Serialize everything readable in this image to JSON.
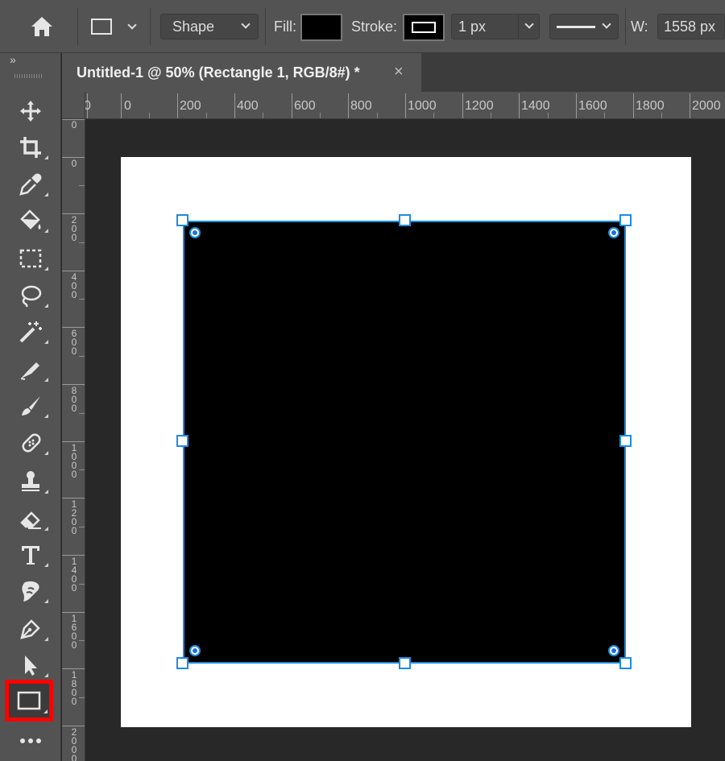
{
  "options_bar": {
    "home_icon": "home-icon",
    "shape_mode_icon": "rectangle-shape-icon",
    "mode_select": "Shape",
    "fill_label": "Fill:",
    "fill_color": "#000000",
    "stroke_label": "Stroke:",
    "stroke_icon": "stroke-swatch-icon",
    "stroke_width": "1 px",
    "stroke_style_icon": "stroke-line-style-icon",
    "width_label": "W:",
    "width_value": "1558 px"
  },
  "toolbar": {
    "collapse_icon": "»",
    "tools": [
      {
        "name": "move-tool",
        "icon": "move-icon"
      },
      {
        "name": "crop-tool",
        "icon": "crop-icon"
      },
      {
        "name": "eyedropper-tool",
        "icon": "eyedropper-icon"
      },
      {
        "name": "paint-bucket-tool",
        "icon": "paint-bucket-icon"
      },
      {
        "name": "marquee-tool",
        "icon": "rectangular-marquee-icon"
      },
      {
        "name": "lasso-tool",
        "icon": "lasso-icon"
      },
      {
        "name": "magic-wand-tool",
        "icon": "magic-wand-icon"
      },
      {
        "name": "eraser-tool",
        "icon": "eraser-icon"
      },
      {
        "name": "brush-tool",
        "icon": "brush-icon"
      },
      {
        "name": "healing-brush-tool",
        "icon": "bandage-icon"
      },
      {
        "name": "clone-stamp-tool",
        "icon": "stamp-icon"
      },
      {
        "name": "background-eraser-tool",
        "icon": "background-eraser-icon"
      },
      {
        "name": "type-tool",
        "icon": "type-icon"
      },
      {
        "name": "smudge-tool",
        "icon": "smudge-finger-icon"
      },
      {
        "name": "pen-tool",
        "icon": "pen-icon"
      },
      {
        "name": "path-selection-tool",
        "icon": "arrow-selection-icon"
      },
      {
        "name": "rectangle-tool",
        "icon": "rectangle-icon",
        "active": true
      },
      {
        "name": "more-tools",
        "icon": "ellipsis-icon"
      }
    ],
    "highlight_color": "#ff0000"
  },
  "document": {
    "tab_title": "Untitled-1 @ 50% (Rectangle 1, RGB/8#) *",
    "close_icon": "×"
  },
  "rulers": {
    "top": [
      "0",
      "0",
      "200",
      "400",
      "600",
      "800",
      "1000",
      "1200",
      "1400",
      "1600",
      "1800",
      "2000"
    ],
    "left": [
      "0",
      "0",
      "200",
      "400",
      "600",
      "800",
      "1000",
      "1200",
      "1400",
      "1600",
      "1800",
      "2000"
    ]
  },
  "canvas": {
    "background": "#ffffff",
    "shape_fill": "#000000",
    "selection_color": "#1d8ce0"
  }
}
